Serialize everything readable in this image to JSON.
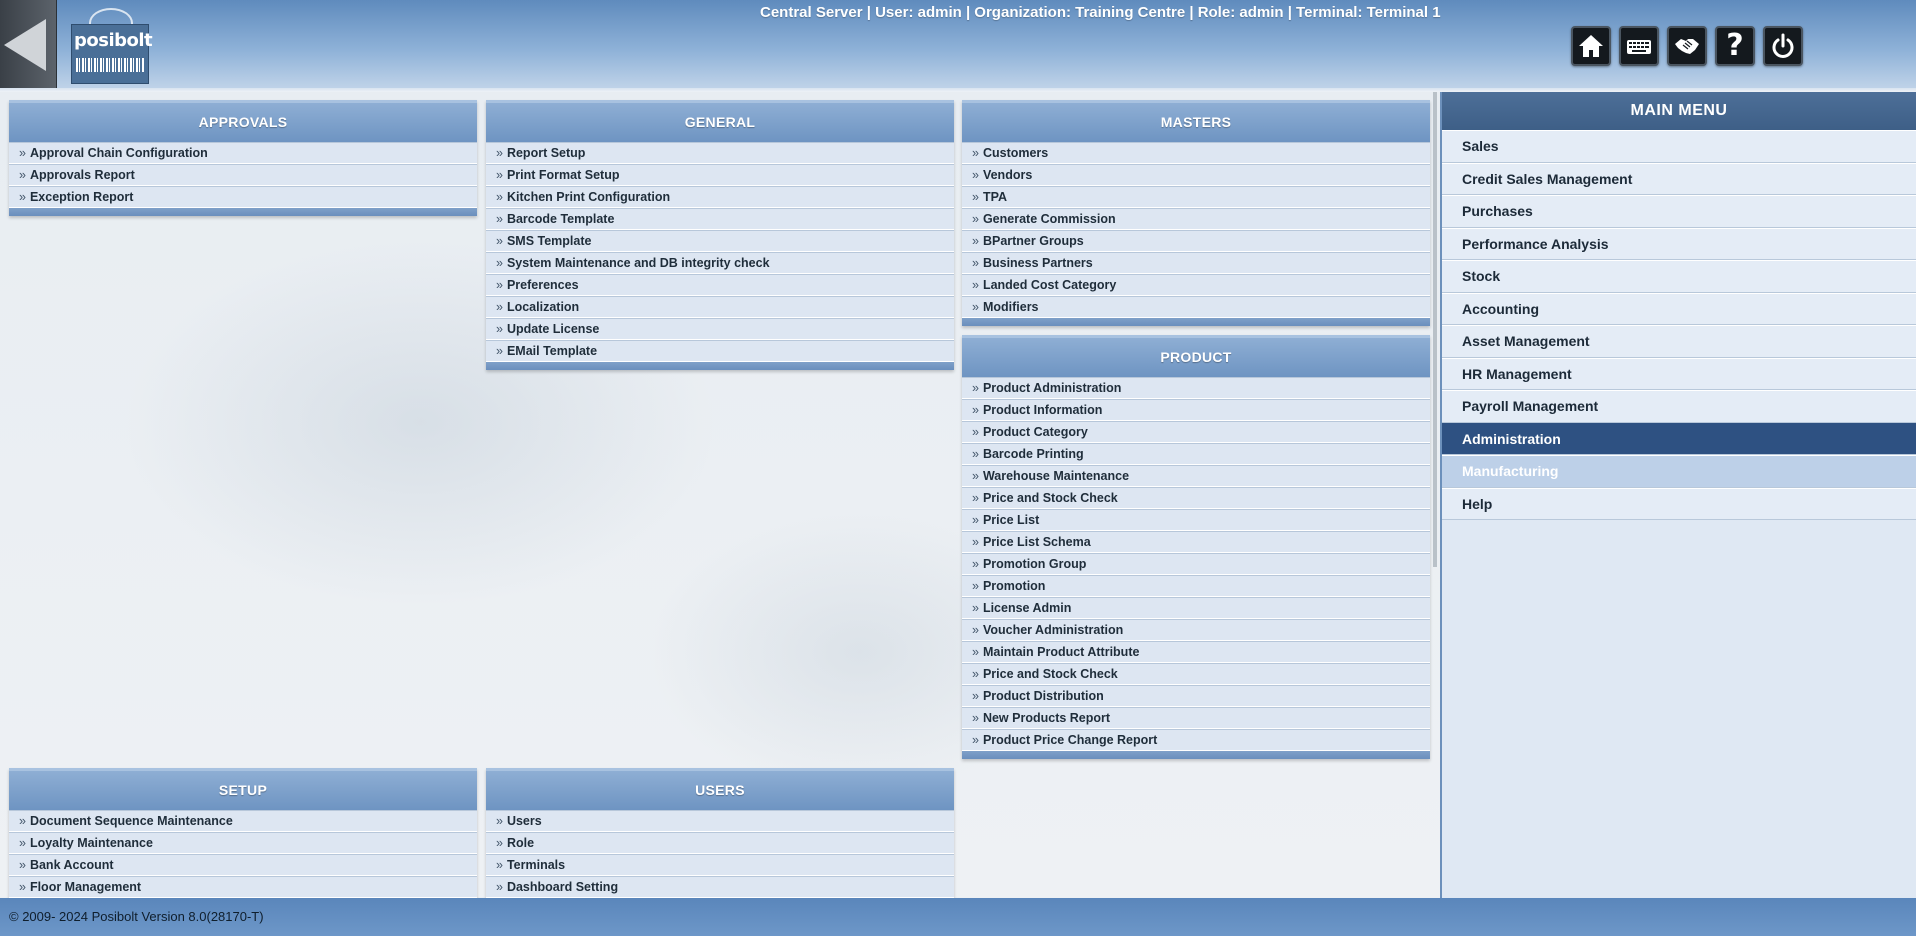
{
  "header": {
    "session_info": "Central Server | User: admin | Organization: Training Centre | Role: admin | Terminal: Terminal 1",
    "logo_text": "posibolt",
    "toolbar": [
      {
        "name": "home-button",
        "icon": "home-icon"
      },
      {
        "name": "keyboard-button",
        "icon": "keyboard-icon"
      },
      {
        "name": "handshake-button",
        "icon": "handshake-icon"
      },
      {
        "name": "help-button",
        "icon": "help-icon",
        "label": "?"
      },
      {
        "name": "logout-button",
        "icon": "power-icon"
      }
    ]
  },
  "panels": {
    "approvals": {
      "title": "APPROVALS",
      "items": [
        "Approval Chain Configuration",
        "Approvals Report",
        "Exception Report"
      ]
    },
    "general": {
      "title": "GENERAL",
      "items": [
        "Report Setup",
        "Print Format Setup",
        "Kitchen Print Configuration",
        "Barcode Template",
        "SMS Template",
        "System Maintenance and DB integrity check",
        "Preferences",
        "Localization",
        "Update License",
        "EMail Template"
      ]
    },
    "masters": {
      "title": "MASTERS",
      "items": [
        "Customers",
        "Vendors",
        "TPA",
        "Generate Commission",
        "BPartner Groups",
        "Business Partners",
        "Landed Cost Category",
        "Modifiers"
      ]
    },
    "product": {
      "title": "PRODUCT",
      "items": [
        "Product Administration",
        "Product Information",
        "Product Category",
        "Barcode Printing",
        "Warehouse Maintenance",
        "Price and Stock Check",
        "Price List",
        "Price List Schema",
        "Promotion Group",
        "Promotion",
        "License Admin",
        "Voucher Administration",
        "Maintain Product Attribute",
        "Price and Stock Check",
        "Product Distribution",
        "New Products Report",
        "Product Price Change Report"
      ]
    },
    "setup": {
      "title": "SETUP",
      "items": [
        "Document Sequence Maintenance",
        "Loyalty Maintenance",
        "Bank Account",
        "Floor Management"
      ]
    },
    "users": {
      "title": "USERS",
      "items": [
        "Users",
        "Role",
        "Terminals",
        "Dashboard Setting"
      ]
    }
  },
  "main_menu": {
    "title": "MAIN MENU",
    "items": [
      "Sales",
      "Credit Sales Management",
      "Purchases",
      "Performance Analysis",
      "Stock",
      "Accounting",
      "Asset Management",
      "HR Management",
      "Payroll Management",
      "Administration",
      "Manufacturing",
      "Help"
    ],
    "active": "Administration",
    "hovered": "Manufacturing"
  },
  "footer": {
    "copyright": "© 2009- 2024 Posibolt Version  8.0(28170-T)"
  },
  "colors": {
    "accent": "#2e5182",
    "panel_header": "#7a9fcb",
    "item_bg": "#dde6f2"
  }
}
